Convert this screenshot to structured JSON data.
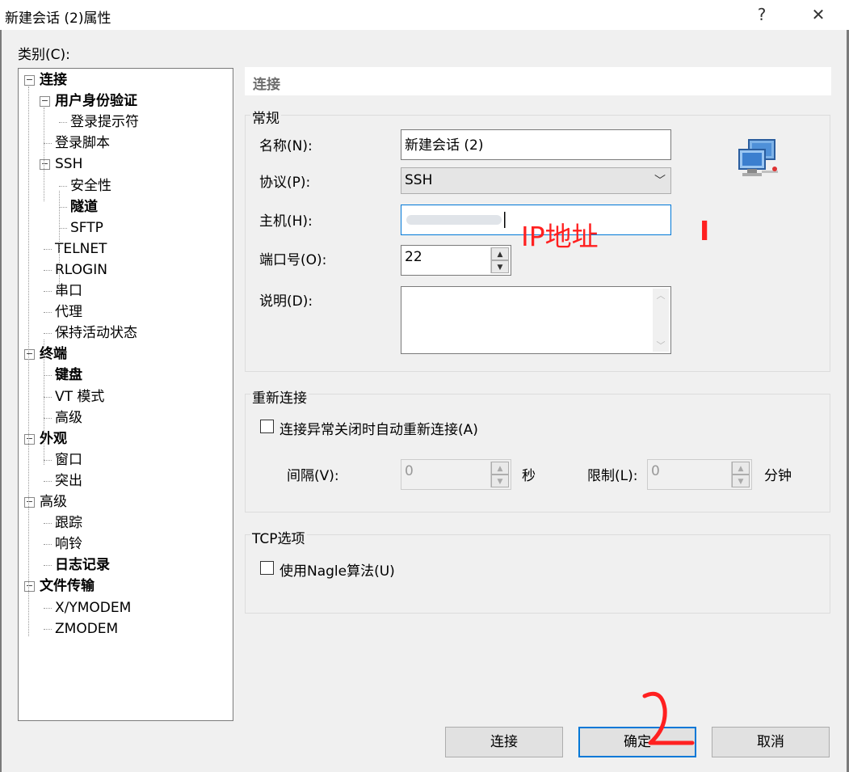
{
  "window": {
    "title": "新建会话 (2)属性",
    "help_glyph": "?",
    "close_glyph": "✕"
  },
  "category_label": "类别(C):",
  "tree": [
    {
      "label": "连接",
      "bold": true,
      "expander": "⊟"
    },
    {
      "label": "用户身份验证",
      "bold": true,
      "expander": "⊟"
    },
    {
      "label": "登录提示符",
      "bold": false
    },
    {
      "label": "登录脚本",
      "bold": false
    },
    {
      "label": "SSH",
      "bold": false,
      "expander": "⊟"
    },
    {
      "label": "安全性",
      "bold": false
    },
    {
      "label": "隧道",
      "bold": true
    },
    {
      "label": "SFTP",
      "bold": false
    },
    {
      "label": "TELNET",
      "bold": false
    },
    {
      "label": "RLOGIN",
      "bold": false
    },
    {
      "label": "串口",
      "bold": false
    },
    {
      "label": "代理",
      "bold": false
    },
    {
      "label": "保持活动状态",
      "bold": false
    },
    {
      "label": "终端",
      "bold": true,
      "expander": "⊟"
    },
    {
      "label": "键盘",
      "bold": true
    },
    {
      "label": "VT 模式",
      "bold": false
    },
    {
      "label": "高级",
      "bold": false
    },
    {
      "label": "外观",
      "bold": true,
      "expander": "⊟"
    },
    {
      "label": "窗口",
      "bold": false
    },
    {
      "label": "突出",
      "bold": false
    },
    {
      "label": "高级",
      "bold": false,
      "expander": "⊟"
    },
    {
      "label": "跟踪",
      "bold": false
    },
    {
      "label": "响铃",
      "bold": false
    },
    {
      "label": "日志记录",
      "bold": true
    },
    {
      "label": "文件传输",
      "bold": true,
      "expander": "⊟"
    },
    {
      "label": "X/YMODEM",
      "bold": false
    },
    {
      "label": "ZMODEM",
      "bold": false
    }
  ],
  "panel_header": "连接",
  "general": {
    "group_label": "常规",
    "name_label": "名称(N):",
    "name_value": "新建会话 (2)",
    "protocol_label": "协议(P):",
    "protocol_value": "SSH",
    "host_label": "主机(H):",
    "host_value": "",
    "port_label": "端口号(O):",
    "port_value": "22",
    "desc_label": "说明(D):",
    "desc_value": ""
  },
  "annotations": {
    "ip_text": "IP地址",
    "mark_one": "I",
    "mark_two": "2"
  },
  "reconnect": {
    "group_label": "重新连接",
    "auto_label": "连接异常关闭时自动重新连接(A)",
    "interval_label": "间隔(V):",
    "interval_value": "0",
    "interval_unit": "秒",
    "limit_label": "限制(L):",
    "limit_value": "0",
    "limit_unit": "分钟"
  },
  "tcp": {
    "group_label": "TCP选项",
    "nagle_label": "使用Nagle算法(U)"
  },
  "buttons": {
    "connect": "连接",
    "ok": "确定",
    "cancel": "取消"
  }
}
